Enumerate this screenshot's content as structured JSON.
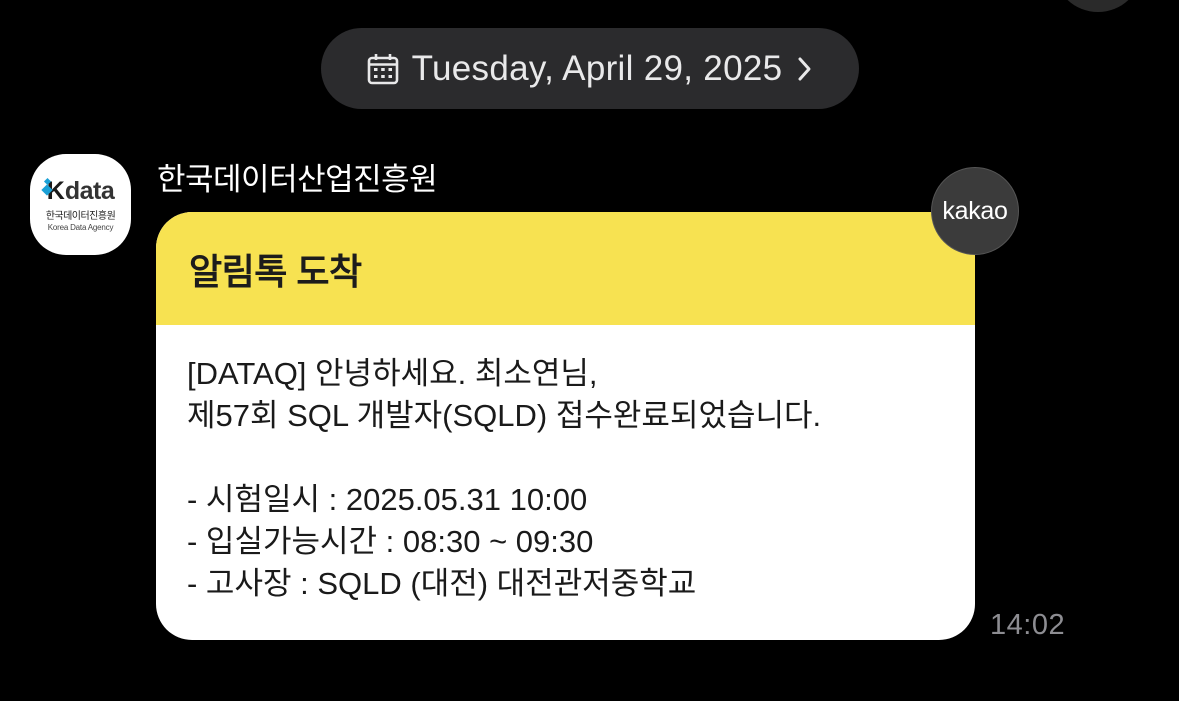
{
  "header": {
    "date_label": "Tuesday, April 29, 2025"
  },
  "sender": {
    "name": "한국데이터산업진흥원",
    "logo": {
      "brand": "data",
      "sub_korean": "한국데이터진흥원",
      "sub_english": "Korea Data Agency"
    }
  },
  "message": {
    "title": "알림톡 도착",
    "lines": [
      "[DATAQ] 안녕하세요. 최소연님,",
      "제57회 SQL 개발자(SQLD) 접수완료되었습니다.",
      "",
      "- 시험일시 : 2025.05.31 10:00",
      "- 입실가능시간 : 08:30 ~ 09:30",
      "- 고사장 : SQLD (대전) 대전관저중학교"
    ],
    "time": "14:02",
    "badge": "kakao"
  },
  "colors": {
    "background": "#000000",
    "header_yellow": "#f7e251",
    "pill": "#2b2b2d",
    "timestamp": "#8d8d92"
  },
  "icons": {
    "date": "calendar-icon",
    "chevron": "chevron-right-icon"
  }
}
